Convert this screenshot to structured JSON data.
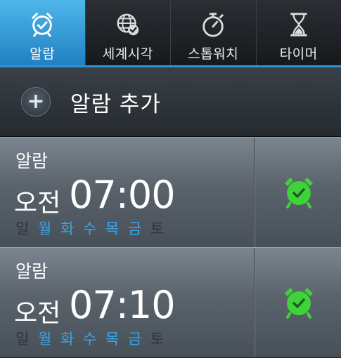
{
  "tabs": [
    {
      "label": "알람",
      "icon": "alarm-clock-icon",
      "active": true
    },
    {
      "label": "세계시각",
      "icon": "world-clock-icon",
      "active": false
    },
    {
      "label": "스톱워치",
      "icon": "stopwatch-icon",
      "active": false
    },
    {
      "label": "타이머",
      "icon": "hourglass-icon",
      "active": false
    }
  ],
  "add_alarm": {
    "label": "알람 추가",
    "icon": "plus-icon"
  },
  "weekdays": [
    "일",
    "월",
    "화",
    "수",
    "목",
    "금",
    "토"
  ],
  "alarms": [
    {
      "name": "알람",
      "ampm": "오전",
      "time": "07:00",
      "active_days": [
        "월",
        "화",
        "수",
        "목",
        "금"
      ],
      "enabled": true
    },
    {
      "name": "알람",
      "ampm": "오전",
      "time": "07:10",
      "active_days": [
        "월",
        "화",
        "수",
        "목",
        "금"
      ],
      "enabled": true
    }
  ],
  "colors": {
    "accent": "#2e95d3",
    "day_active": "#39a7ea",
    "alarm_on": "#3fd33a"
  }
}
